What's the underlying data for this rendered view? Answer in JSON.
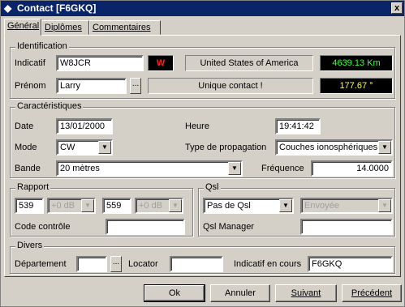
{
  "window": {
    "title": "Contact  [F6GKQ]",
    "close_label": "x"
  },
  "tabs": [
    {
      "label": "Général"
    },
    {
      "label": "Diplômes"
    },
    {
      "label": "Commentaires"
    }
  ],
  "identification": {
    "legend": "Identification",
    "indicatif_label": "Indicatif",
    "indicatif_value": "W8JCR",
    "prefix_badge": "W",
    "country": "United States of America",
    "distance": "4639.13 Km",
    "prenom_label": "Prénom",
    "prenom_value": "Larry",
    "browse_label": "...",
    "contact_status": "Unique contact !",
    "bearing": "177.67 °"
  },
  "caracteristiques": {
    "legend": "Caractéristiques",
    "date_label": "Date",
    "date_value": "13/01/2000",
    "heure_label": "Heure",
    "heure_value": "19:41:42",
    "mode_label": "Mode",
    "mode_value": "CW",
    "propagation_label": "Type de propagation",
    "propagation_value": "Couches ionosphériques",
    "bande_label": "Bande",
    "bande_value": "20 mètres",
    "frequence_label": "Fréquence",
    "frequence_value": "14.0000"
  },
  "rapport": {
    "legend": "Rapport",
    "sent_value": "539",
    "sent_db": "+0 dB",
    "recv_value": "559",
    "recv_db": "+0 dB",
    "code_label": "Code contrôle",
    "code_value": ""
  },
  "qsl": {
    "legend": "Qsl",
    "qsl_value": "Pas de Qsl",
    "envoyee_value": "Envoyée",
    "manager_label": "Qsl Manager",
    "manager_value": ""
  },
  "divers": {
    "legend": "Divers",
    "departement_label": "Département",
    "departement_value": "",
    "browse_label": "...",
    "locator_label": "Locator",
    "locator_value": "",
    "indicatif_cours_label": "Indicatif en cours",
    "indicatif_cours_value": "F6GKQ"
  },
  "buttons": {
    "ok": "Ok",
    "annuler": "Annuler",
    "suivant": "Suivant",
    "precedent": "Précédent"
  },
  "colors": {
    "title_bg": "#0a246a",
    "dialog_bg": "#d4d0c8",
    "lcd_bg": "#000000",
    "lcd_green": "#3cff3c",
    "lcd_yellow": "#ffff40",
    "badge_red": "#ff2020"
  }
}
